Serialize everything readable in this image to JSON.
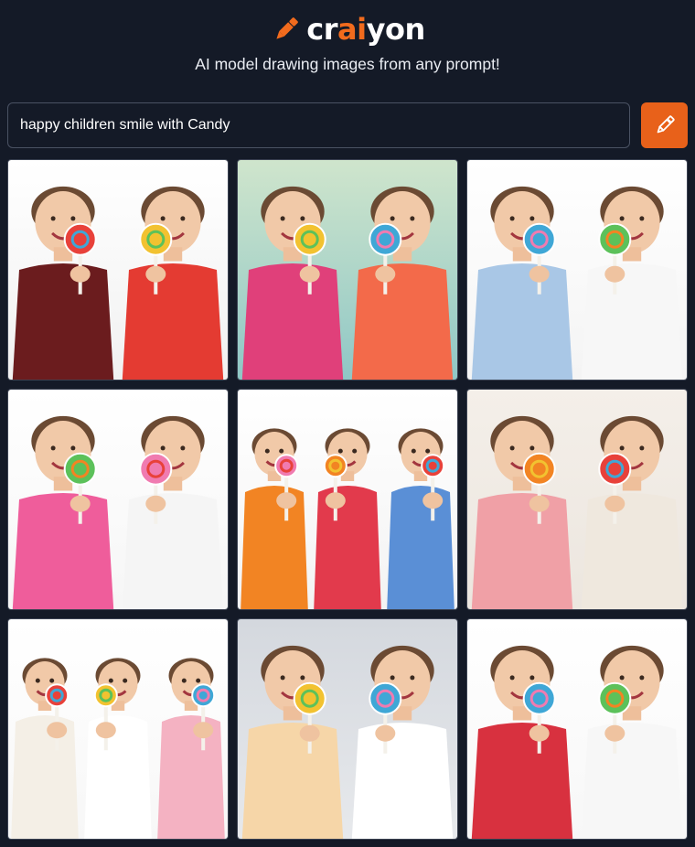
{
  "brand": {
    "name_before": "cr",
    "name_accent": "ai",
    "name_after": "yon",
    "tagline": "AI model drawing images from any prompt!",
    "accent_color": "#f26b1d"
  },
  "search": {
    "value": "happy children smile with Candy",
    "button_icon": "pencil-icon"
  },
  "results": [
    {
      "bg1": "#ffffff",
      "bg2": "#f1f1f1",
      "shirts": [
        "#6b1c1e",
        "#e43b32"
      ]
    },
    {
      "bg1": "#cfe5cc",
      "bg2": "#8fc7c6",
      "shirts": [
        "#e0407a",
        "#f36a4a"
      ]
    },
    {
      "bg1": "#ffffff",
      "bg2": "#f4f4f4",
      "shirts": [
        "#a9c7e6",
        "#f7f7f7"
      ]
    },
    {
      "bg1": "#ffffff",
      "bg2": "#f6f6f6",
      "shirts": [
        "#ef5d9b",
        "#f5f5f5"
      ]
    },
    {
      "bg1": "#ffffff",
      "bg2": "#f3f3f3",
      "shirts": [
        "#f28423",
        "#e23a4c",
        "#5a8fd6"
      ]
    },
    {
      "bg1": "#f4efe9",
      "bg2": "#ece6df",
      "shirts": [
        "#f0a0a6",
        "#efe8de"
      ]
    },
    {
      "bg1": "#ffffff",
      "bg2": "#f7f7f7",
      "shirts": [
        "#f4efe6",
        "#ffffff",
        "#f4b2c2"
      ]
    },
    {
      "bg1": "#d4d8de",
      "bg2": "#e7e9ec",
      "shirts": [
        "#f6d6a8",
        "#ffffff"
      ]
    },
    {
      "bg1": "#ffffff",
      "bg2": "#f7f7f7",
      "shirts": [
        "#d8313f",
        "#f7f7f7"
      ]
    }
  ]
}
